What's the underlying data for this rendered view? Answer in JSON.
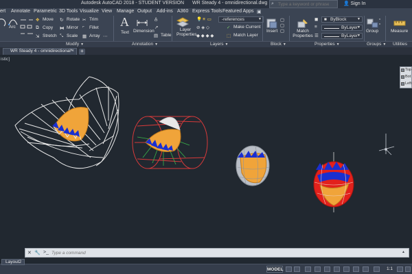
{
  "title_bar": {
    "app_title": "Autodesk AutoCAD 2018 - STUDENT VERSION",
    "file_name": "WR Steady 4 - omnidirectional.dwg"
  },
  "menu": {
    "tabs": [
      "ert",
      "Annotate",
      "Parametric",
      "3D Tools",
      "Visualize",
      "View",
      "Manage",
      "Output",
      "Add-ins",
      "A360",
      "Express Tools",
      "Featured Apps"
    ],
    "search_placeholder": "Type a keyword or phrase",
    "sign_in": "Sign In"
  },
  "ribbon": {
    "draw": {
      "arc": "Arc"
    },
    "modify": [
      "Move",
      "Rotate",
      "Trim",
      "Copy",
      "Mirror",
      "Fillet",
      "Stretch",
      "Scale",
      "Array"
    ],
    "annotation": {
      "text": "Text",
      "dimension": "Dimension",
      "table": "Table"
    },
    "layers": {
      "layer_properties": "Layer Properties",
      "layer_combo": "-references",
      "make_current": "Make Current",
      "match_layer": "Match Layer"
    },
    "block": {
      "insert": "Insert"
    },
    "properties": {
      "match_properties": "Match Properties",
      "color": "ByBlock",
      "linetype": "ByLayer",
      "lineweight": "ByLayer"
    },
    "groups": {
      "group": "Group"
    },
    "utilities": {
      "measure": "Measure"
    }
  },
  "panel_titles": [
    "Modify",
    "Annotation",
    "Layers",
    "Block",
    "Properties",
    "Groups",
    "Utilities"
  ],
  "document_tab": {
    "name": "WR Steady 4 - omnidirectional*"
  },
  "viewport": {
    "label": "istic]",
    "viewcube": [
      "Top",
      "Bot",
      "Left"
    ]
  },
  "command_line": {
    "placeholder": "Type a command"
  },
  "status_bar": {
    "layout_tab": "Layout2",
    "model_button": "MODEL",
    "zoom_level": "1:1"
  },
  "colors": {
    "background": "#212830",
    "ribbon": "#3b4453",
    "wire_white": "#e8e8e8",
    "wire_red": "#d83a3a",
    "blue_fill": "#1a2fd0",
    "orange_fill": "#f0a43a",
    "red_fill": "#e2211c"
  }
}
